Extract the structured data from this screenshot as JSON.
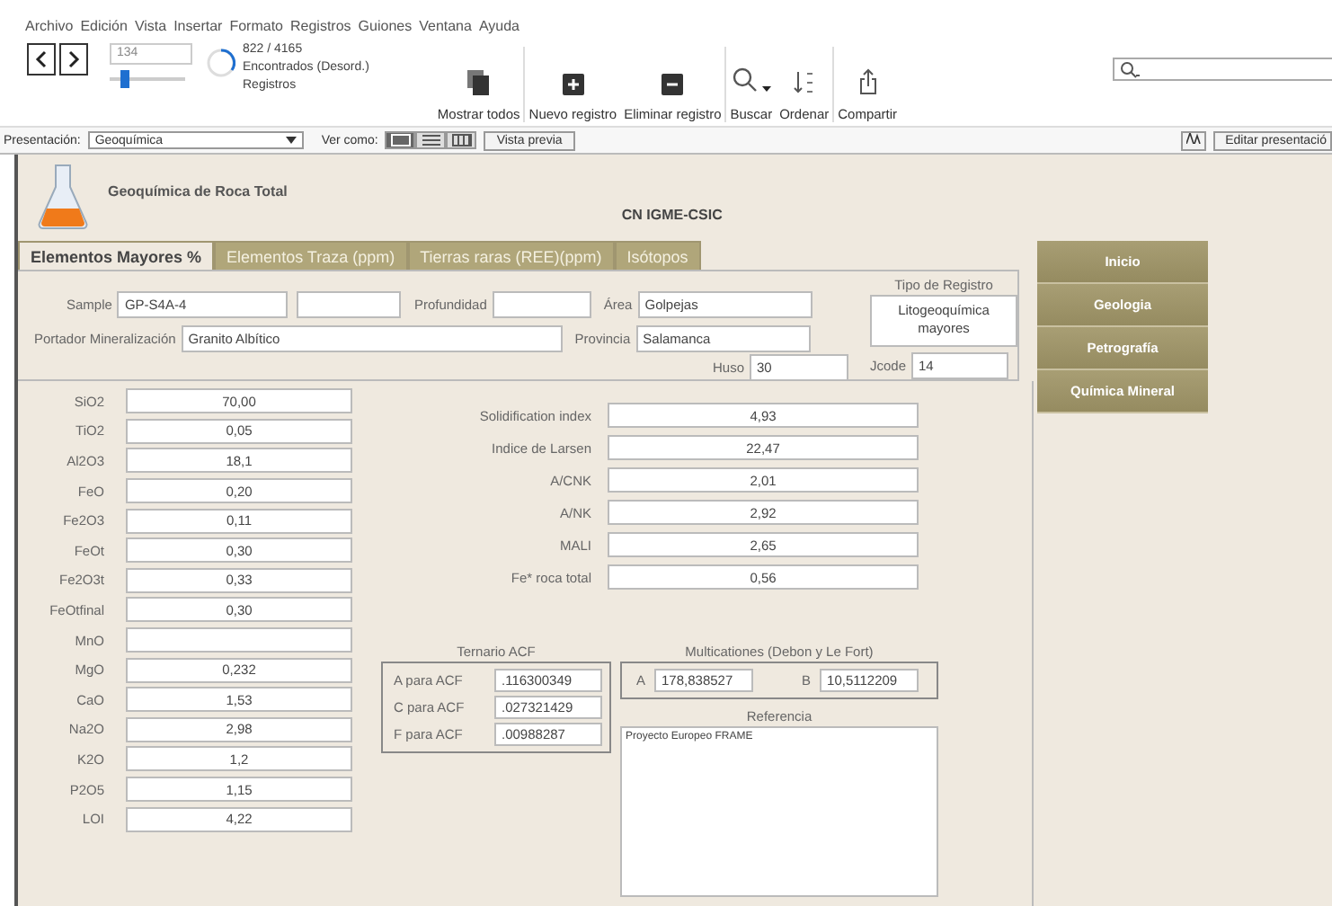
{
  "menu": [
    "Archivo",
    "Edición",
    "Vista",
    "Insertar",
    "Formato",
    "Registros",
    "Guiones",
    "Ventana",
    "Ayuda"
  ],
  "toolbar": {
    "record": "134",
    "slider": {
      "level": 0.15
    },
    "found": "822 / 4165",
    "found_status": "Encontrados (Desord.)",
    "records_label": "Registros",
    "buttons": [
      {
        "label": "Mostrar todos",
        "kind": "stack"
      },
      {
        "label": "Nuevo registro",
        "kind": "plus"
      },
      {
        "label": "Eliminar registro",
        "kind": "minus"
      },
      {
        "label": "Buscar",
        "kind": "search"
      },
      {
        "label": "Ordenar",
        "kind": "sort"
      },
      {
        "label": "Compartir",
        "kind": "share"
      }
    ]
  },
  "layout_bar": {
    "label": "Presentación:",
    "layout": "Geoquímica",
    "view_label": "Ver como:",
    "views": [
      {
        "kind": "form",
        "selected": true
      },
      {
        "kind": "list",
        "selected": false
      },
      {
        "kind": "table",
        "selected": false
      }
    ],
    "preview": "Vista previa",
    "edit": "Editar presentació"
  },
  "header": {
    "title": "Geoquímica de Roca Total",
    "org": "CN IGME-CSIC"
  },
  "tabs": [
    {
      "label": "Elementos Mayores %",
      "selected": true
    },
    {
      "label": "Elementos Traza (ppm)",
      "selected": false
    },
    {
      "label": "Tierras raras (REE)(ppm)",
      "selected": false
    },
    {
      "label": "Isótopos",
      "selected": false
    }
  ],
  "record": {
    "sample": {
      "label": "Sample",
      "value": "GP-S4A-4"
    },
    "depth": {
      "label": "Profundidad"
    },
    "area": {
      "label": "Área",
      "value": "Golpejas"
    },
    "carrier": {
      "label": "Portador Mineralización",
      "value": "Granito Albítico"
    },
    "province": {
      "label": "Provincia",
      "value": "Salamanca"
    },
    "huso": {
      "label": "Huso",
      "value": "30"
    },
    "jcode": {
      "label": "Jcode",
      "value": "14"
    },
    "type": {
      "title": "Tipo de Registro",
      "value": "Litogeoquímica mayores"
    }
  },
  "oxides": [
    {
      "label": "SiO2",
      "value": "70,00"
    },
    {
      "label": "TiO2",
      "value": "0,05"
    },
    {
      "label": "Al2O3",
      "value": "18,1"
    },
    {
      "label": "FeO",
      "value": "0,20"
    },
    {
      "label": "Fe2O3",
      "value": "0,11"
    },
    {
      "label": "FeOt",
      "value": "0,30"
    },
    {
      "label": "Fe2O3t",
      "value": "0,33"
    },
    {
      "label": "FeOtfinal",
      "value": "0,30"
    },
    {
      "label": "MnO"
    },
    {
      "label": "MgO",
      "value": "0,232"
    },
    {
      "label": "CaO",
      "value": "1,53"
    },
    {
      "label": "Na2O",
      "value": "2,98"
    },
    {
      "label": "K2O",
      "value": "1,2"
    },
    {
      "label": "P2O5",
      "value": "1,15"
    },
    {
      "label": "LOI",
      "value": "4,22"
    }
  ],
  "indices": [
    {
      "label": "Solidification index",
      "value": "4,93"
    },
    {
      "label": "Indice de Larsen",
      "value": "22,47"
    },
    {
      "label": "A/CNK",
      "value": "2,01"
    },
    {
      "label": "A/NK",
      "value": "2,92"
    },
    {
      "label": "MALI",
      "value": "2,65"
    },
    {
      "label": "Fe* roca total",
      "value": "0,56"
    }
  ],
  "acf": {
    "title": "Ternario ACF",
    "rows": [
      {
        "label": "A para ACF",
        "value": ".116300349"
      },
      {
        "label": "C para ACF",
        "value": ".027321429"
      },
      {
        "label": "F para ACF",
        "value": ".00988287"
      }
    ]
  },
  "multications": {
    "title": "Multicationes  (Debon y Le Fort)",
    "rows": [
      {
        "label": "A",
        "value": "178,838527"
      },
      {
        "label": "B",
        "value": "10,5112209"
      }
    ]
  },
  "reference": {
    "title": "Referencia",
    "value": "Proyecto Europeo FRAME"
  },
  "nav": [
    {
      "label": "Inicio"
    },
    {
      "label": "Geologia"
    },
    {
      "label": "Petrografía"
    },
    {
      "label": "Química Mineral"
    }
  ]
}
